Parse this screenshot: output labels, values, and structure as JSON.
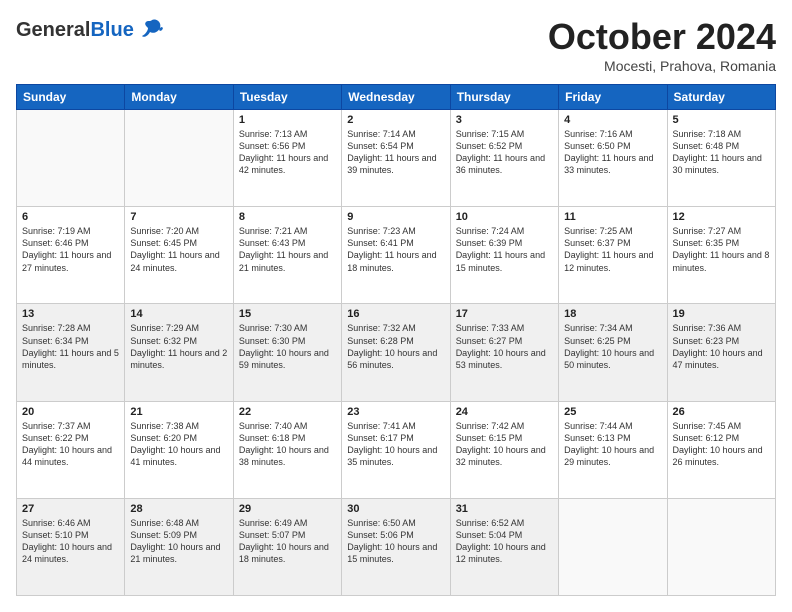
{
  "header": {
    "logo_general": "General",
    "logo_blue": "Blue",
    "month_title": "October 2024",
    "location": "Mocesti, Prahova, Romania"
  },
  "days_of_week": [
    "Sunday",
    "Monday",
    "Tuesday",
    "Wednesday",
    "Thursday",
    "Friday",
    "Saturday"
  ],
  "weeks": [
    [
      {
        "day": "",
        "info": "",
        "empty": true
      },
      {
        "day": "",
        "info": "",
        "empty": true
      },
      {
        "day": "1",
        "info": "Sunrise: 7:13 AM\nSunset: 6:56 PM\nDaylight: 11 hours and 42 minutes."
      },
      {
        "day": "2",
        "info": "Sunrise: 7:14 AM\nSunset: 6:54 PM\nDaylight: 11 hours and 39 minutes."
      },
      {
        "day": "3",
        "info": "Sunrise: 7:15 AM\nSunset: 6:52 PM\nDaylight: 11 hours and 36 minutes."
      },
      {
        "day": "4",
        "info": "Sunrise: 7:16 AM\nSunset: 6:50 PM\nDaylight: 11 hours and 33 minutes."
      },
      {
        "day": "5",
        "info": "Sunrise: 7:18 AM\nSunset: 6:48 PM\nDaylight: 11 hours and 30 minutes."
      }
    ],
    [
      {
        "day": "6",
        "info": "Sunrise: 7:19 AM\nSunset: 6:46 PM\nDaylight: 11 hours and 27 minutes."
      },
      {
        "day": "7",
        "info": "Sunrise: 7:20 AM\nSunset: 6:45 PM\nDaylight: 11 hours and 24 minutes."
      },
      {
        "day": "8",
        "info": "Sunrise: 7:21 AM\nSunset: 6:43 PM\nDaylight: 11 hours and 21 minutes."
      },
      {
        "day": "9",
        "info": "Sunrise: 7:23 AM\nSunset: 6:41 PM\nDaylight: 11 hours and 18 minutes."
      },
      {
        "day": "10",
        "info": "Sunrise: 7:24 AM\nSunset: 6:39 PM\nDaylight: 11 hours and 15 minutes."
      },
      {
        "day": "11",
        "info": "Sunrise: 7:25 AM\nSunset: 6:37 PM\nDaylight: 11 hours and 12 minutes."
      },
      {
        "day": "12",
        "info": "Sunrise: 7:27 AM\nSunset: 6:35 PM\nDaylight: 11 hours and 8 minutes."
      }
    ],
    [
      {
        "day": "13",
        "info": "Sunrise: 7:28 AM\nSunset: 6:34 PM\nDaylight: 11 hours and 5 minutes.",
        "shaded": true
      },
      {
        "day": "14",
        "info": "Sunrise: 7:29 AM\nSunset: 6:32 PM\nDaylight: 11 hours and 2 minutes.",
        "shaded": true
      },
      {
        "day": "15",
        "info": "Sunrise: 7:30 AM\nSunset: 6:30 PM\nDaylight: 10 hours and 59 minutes.",
        "shaded": true
      },
      {
        "day": "16",
        "info": "Sunrise: 7:32 AM\nSunset: 6:28 PM\nDaylight: 10 hours and 56 minutes.",
        "shaded": true
      },
      {
        "day": "17",
        "info": "Sunrise: 7:33 AM\nSunset: 6:27 PM\nDaylight: 10 hours and 53 minutes.",
        "shaded": true
      },
      {
        "day": "18",
        "info": "Sunrise: 7:34 AM\nSunset: 6:25 PM\nDaylight: 10 hours and 50 minutes.",
        "shaded": true
      },
      {
        "day": "19",
        "info": "Sunrise: 7:36 AM\nSunset: 6:23 PM\nDaylight: 10 hours and 47 minutes.",
        "shaded": true
      }
    ],
    [
      {
        "day": "20",
        "info": "Sunrise: 7:37 AM\nSunset: 6:22 PM\nDaylight: 10 hours and 44 minutes."
      },
      {
        "day": "21",
        "info": "Sunrise: 7:38 AM\nSunset: 6:20 PM\nDaylight: 10 hours and 41 minutes."
      },
      {
        "day": "22",
        "info": "Sunrise: 7:40 AM\nSunset: 6:18 PM\nDaylight: 10 hours and 38 minutes."
      },
      {
        "day": "23",
        "info": "Sunrise: 7:41 AM\nSunset: 6:17 PM\nDaylight: 10 hours and 35 minutes."
      },
      {
        "day": "24",
        "info": "Sunrise: 7:42 AM\nSunset: 6:15 PM\nDaylight: 10 hours and 32 minutes."
      },
      {
        "day": "25",
        "info": "Sunrise: 7:44 AM\nSunset: 6:13 PM\nDaylight: 10 hours and 29 minutes."
      },
      {
        "day": "26",
        "info": "Sunrise: 7:45 AM\nSunset: 6:12 PM\nDaylight: 10 hours and 26 minutes."
      }
    ],
    [
      {
        "day": "27",
        "info": "Sunrise: 6:46 AM\nSunset: 5:10 PM\nDaylight: 10 hours and 24 minutes.",
        "shaded": true
      },
      {
        "day": "28",
        "info": "Sunrise: 6:48 AM\nSunset: 5:09 PM\nDaylight: 10 hours and 21 minutes.",
        "shaded": true
      },
      {
        "day": "29",
        "info": "Sunrise: 6:49 AM\nSunset: 5:07 PM\nDaylight: 10 hours and 18 minutes.",
        "shaded": true
      },
      {
        "day": "30",
        "info": "Sunrise: 6:50 AM\nSunset: 5:06 PM\nDaylight: 10 hours and 15 minutes.",
        "shaded": true
      },
      {
        "day": "31",
        "info": "Sunrise: 6:52 AM\nSunset: 5:04 PM\nDaylight: 10 hours and 12 minutes.",
        "shaded": true
      },
      {
        "day": "",
        "info": "",
        "empty": true
      },
      {
        "day": "",
        "info": "",
        "empty": true
      }
    ]
  ]
}
